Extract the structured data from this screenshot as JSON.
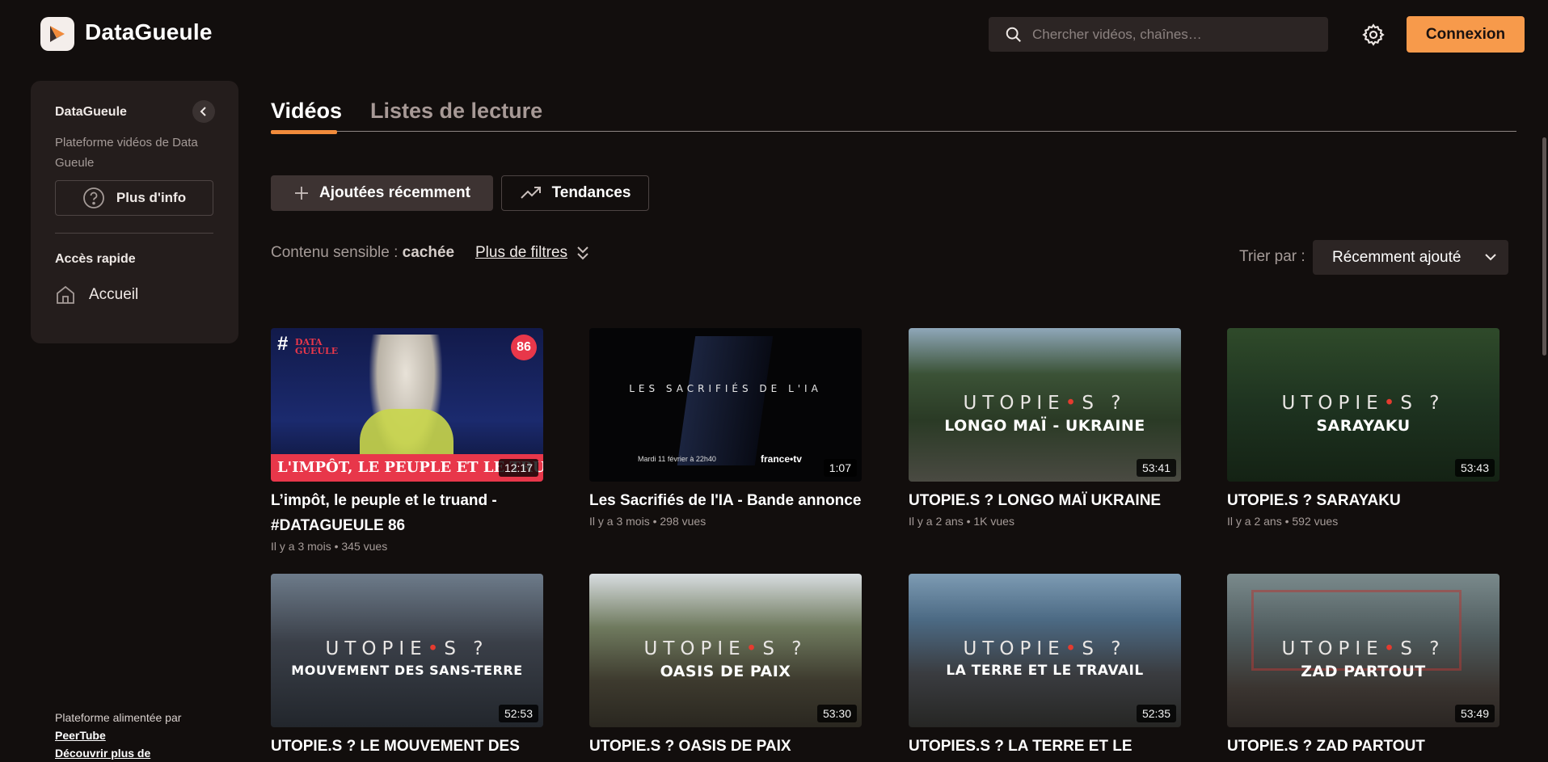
{
  "header": {
    "brand": "DataGueule",
    "search_placeholder": "Chercher vidéos, chaînes…",
    "login_label": "Connexion"
  },
  "sidebar": {
    "title": "DataGueule",
    "description": "Plateforme vidéos de Data Gueule",
    "info_button": "Plus d'info",
    "quick_access_heading": "Accès rapide",
    "home_label": "Accueil",
    "footer_powered": "Plateforme alimentée par",
    "footer_link": "PeerTube",
    "footer_discover": "Découvrir plus de"
  },
  "tabs": {
    "videos": "Vidéos",
    "playlists": "Listes de lecture"
  },
  "filters": {
    "recent": "Ajoutées récemment",
    "trending": "Tendances",
    "sensitive_label": "Contenu sensible :",
    "sensitive_value": "cachée",
    "more_filters": "Plus de filtres",
    "sort_label": "Trier par :",
    "sort_value": "Récemment ajouté"
  },
  "videos": [
    {
      "title": "L’impôt, le peuple et le truand - #DATAGUEULE 86",
      "meta": "Il y a 3 mois • 345 vues",
      "duration": "12:17",
      "overlay": "L'IMPÔT, LE PEUPLE ET LE TRU",
      "badge": "86",
      "brand_mark": "DATA GUEULE"
    },
    {
      "title": "Les Sacrifiés de l'IA - Bande annonce",
      "meta": "Il y a 3 mois • 298 vues",
      "duration": "1:07",
      "overlay": "LES SACRIFIÉS DE L'IA",
      "broadcast": "Mardi 11 février à 22h40",
      "channel": "france•tv"
    },
    {
      "title": "UTOPIE.S ? LONGO MAÏ UKRAINE",
      "meta": "Il y a 2 ans • 1K vues",
      "duration": "53:41",
      "overlay": "LONGO MAÏ - UKRAINE"
    },
    {
      "title": "UTOPIE.S ? SARAYAKU",
      "meta": "Il y a 2 ans • 592 vues",
      "duration": "53:43",
      "overlay": "SARAYAKU"
    },
    {
      "title": "UTOPIE.S ? LE MOUVEMENT DES",
      "meta": "",
      "duration": "52:53",
      "overlay": "MOUVEMENT DES SANS-TERRE"
    },
    {
      "title": "UTOPIE.S ? OASIS DE PAIX",
      "meta": "",
      "duration": "53:30",
      "overlay": "OASIS DE PAIX"
    },
    {
      "title": "UTOPIES.S ? LA TERRE ET LE",
      "meta": "",
      "duration": "52:35",
      "overlay": "LA TERRE ET LE TRAVAIL"
    },
    {
      "title": "UTOPIE.S ? ZAD PARTOUT",
      "meta": "",
      "duration": "53:49",
      "overlay": "ZAD PARTOUT"
    }
  ],
  "utopie_mark": {
    "before": "UTOPIE",
    "dot": "•",
    "after": "S ?"
  },
  "colors": {
    "accent": "#f79a4b",
    "tab_underline": "#f28b3b",
    "background": "#120e0d",
    "sidebar": "#241d1c"
  }
}
